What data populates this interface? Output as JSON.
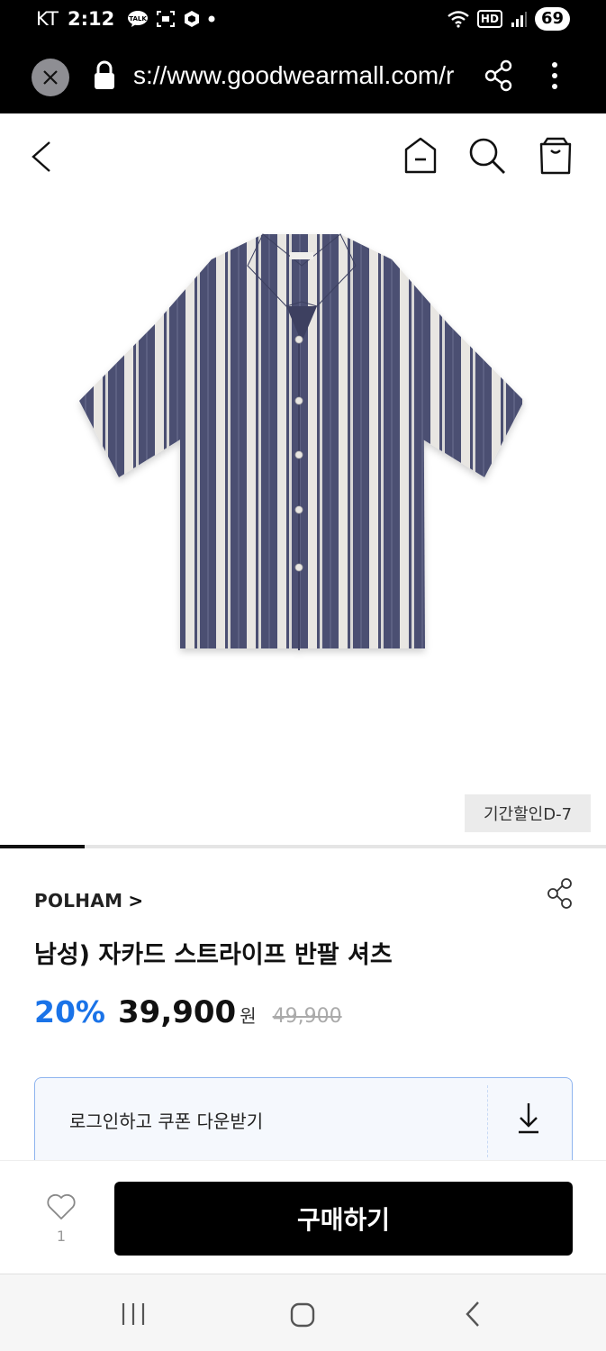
{
  "status_bar": {
    "carrier": "KT",
    "time": "2:12",
    "battery": "69",
    "hd_label": "HD",
    "talk_label": "TALK"
  },
  "browser": {
    "url": "s://www.goodwearmall.com/r"
  },
  "product": {
    "image_alt": "navy and white striped short sleeve shirt",
    "discount_badge": "기간할인D-7",
    "image_progress": 0.14,
    "brand": "POLHAM",
    "brand_chevron": ">",
    "title": "남성) 자카드 스트라이프 반팔 셔츠",
    "discount_rate": "20%",
    "sale_price": "39,900",
    "currency": "원",
    "original_price": "49,900"
  },
  "coupon": {
    "text": "로그인하고 쿠폰 다운받기"
  },
  "bottom_bar": {
    "like_count": "1",
    "buy_label": "구매하기"
  },
  "colors": {
    "accent": "#1a73e8",
    "coupon_border": "#8eb4ef",
    "shirt_navy": "#4b5072",
    "shirt_stripe": "#e8e6e2"
  }
}
